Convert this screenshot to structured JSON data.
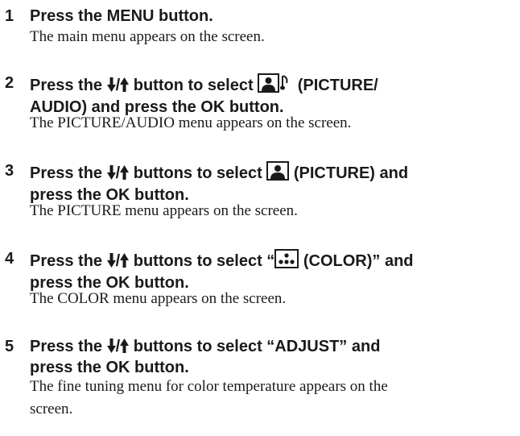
{
  "steps": [
    {
      "number": "1",
      "head": [
        "Press the MENU button."
      ],
      "desc": "The main menu appears on the screen."
    },
    {
      "number": "2",
      "head_l1_a": "Press the ",
      "head_l1_slash": "/",
      "head_l1_b": " button to select ",
      "head_l1_c": " (PICTURE/",
      "head_l2": "AUDIO) and press the OK button.",
      "icon": "picture-audio-icon",
      "desc": "The PICTURE/AUDIO menu appears on the screen."
    },
    {
      "number": "3",
      "head_l1_a": "Press the ",
      "head_l1_slash": "/",
      "head_l1_b": " buttons to select ",
      "head_l1_c": " (PICTURE) and",
      "head_l2": "press the OK button.",
      "icon": "picture-icon",
      "desc": "The PICTURE menu appears on the screen."
    },
    {
      "number": "4",
      "head_l1_a": "Press the ",
      "head_l1_slash": "/",
      "head_l1_b": " buttons to select “",
      "head_l1_c": " (COLOR)” and",
      "head_l2": "press the OK button.",
      "icon": "color-icon",
      "desc": "The COLOR menu appears on the screen."
    },
    {
      "number": "5",
      "head_l1_a": "Press the ",
      "head_l1_slash": "/",
      "head_l1_b": " buttons to select “ADJUST” and",
      "head_l2": "press the OK button.",
      "desc_l1": "The fine tuning menu for color temperature appears on the",
      "desc_l2": "screen."
    }
  ],
  "icons": {
    "down_arrow": "down-arrow-icon",
    "up_arrow": "up-arrow-icon"
  }
}
